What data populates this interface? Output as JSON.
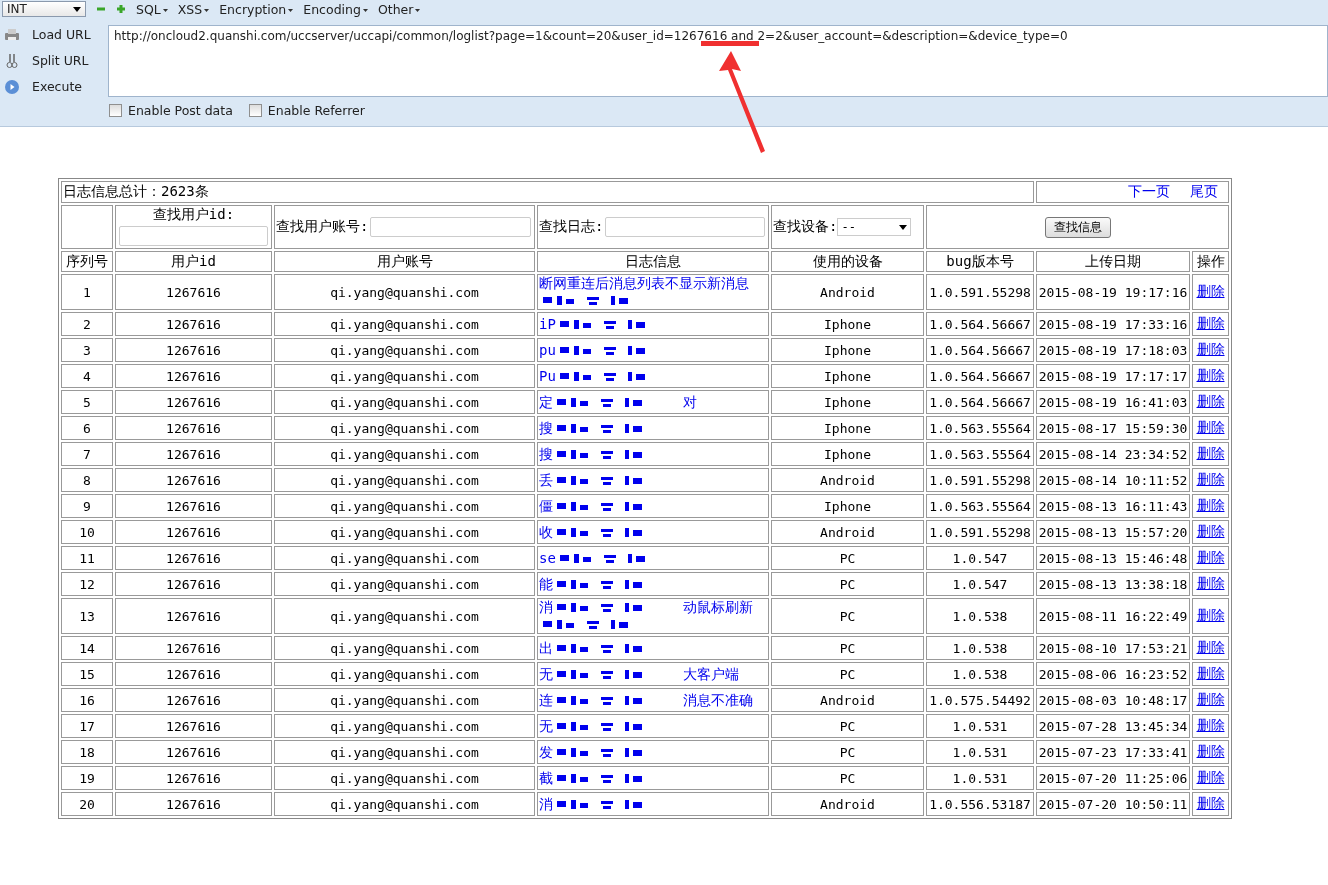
{
  "toolbar": {
    "type_select": "INT",
    "menus": [
      "SQL",
      "XSS",
      "Encryption",
      "Encoding",
      "Other"
    ]
  },
  "actions": [
    {
      "kind": "load",
      "label": "Load URL"
    },
    {
      "kind": "split",
      "label": "Split URL"
    },
    {
      "kind": "execute",
      "label": "Execute"
    }
  ],
  "url": "http://oncloud2.quanshi.com/uccserver/uccapi/common/loglist?page=1&count=20&user_id=1267616 and 2=2&user_account=&description=&device_type=0",
  "options": [
    {
      "label": "Enable Post data",
      "checked": false
    },
    {
      "label": "Enable Referrer",
      "checked": false
    }
  ],
  "summary": "日志信息总计：2623条",
  "pager": [
    "下一页",
    "尾页"
  ],
  "filters": {
    "user_id_label": "查找用户id:",
    "account_label": "查找用户账号:",
    "log_label": "查找日志:",
    "device_label": "查找设备:",
    "device_value": "--",
    "button": "查找信息"
  },
  "columns": [
    "序列号",
    "用户id",
    "用户账号",
    "日志信息",
    "使用的设备",
    "bug版本号",
    "上传日期",
    "操作"
  ],
  "rows": [
    {
      "n": "1",
      "id": "1267616",
      "account": "qi.yang@quanshi.com",
      "log": [
        {
          "kind": "text",
          "text": "断网重连后消息列表不显示新消息"
        },
        {
          "kind": "redacted"
        }
      ],
      "device": "Android",
      "version": "1.0.591.55298",
      "date": "2015-08-19 19:17:16",
      "action": "删除"
    },
    {
      "n": "2",
      "id": "1267616",
      "account": "qi.yang@quanshi.com",
      "log": [
        {
          "kind": "text",
          "text": "iP"
        },
        {
          "kind": "redacted"
        }
      ],
      "device": "Iphone",
      "version": "1.0.564.56667",
      "date": "2015-08-19 17:33:16",
      "action": "删除"
    },
    {
      "n": "3",
      "id": "1267616",
      "account": "qi.yang@quanshi.com",
      "log": [
        {
          "kind": "text",
          "text": "pu"
        },
        {
          "kind": "redacted"
        }
      ],
      "device": "Iphone",
      "version": "1.0.564.56667",
      "date": "2015-08-19 17:18:03",
      "action": "删除"
    },
    {
      "n": "4",
      "id": "1267616",
      "account": "qi.yang@quanshi.com",
      "log": [
        {
          "kind": "text",
          "text": "Pu"
        },
        {
          "kind": "redacted"
        }
      ],
      "device": "Iphone",
      "version": "1.0.564.56667",
      "date": "2015-08-19 17:17:17",
      "action": "删除"
    },
    {
      "n": "5",
      "id": "1267616",
      "account": "qi.yang@quanshi.com",
      "log": [
        {
          "kind": "text",
          "text": "定"
        },
        {
          "kind": "redacted"
        },
        {
          "kind": "text",
          "text": "对"
        }
      ],
      "device": "Iphone",
      "version": "1.0.564.56667",
      "date": "2015-08-19 16:41:03",
      "action": "删除"
    },
    {
      "n": "6",
      "id": "1267616",
      "account": "qi.yang@quanshi.com",
      "log": [
        {
          "kind": "text",
          "text": "搜"
        },
        {
          "kind": "redacted"
        }
      ],
      "device": "Iphone",
      "version": "1.0.563.55564",
      "date": "2015-08-17 15:59:30",
      "action": "删除"
    },
    {
      "n": "7",
      "id": "1267616",
      "account": "qi.yang@quanshi.com",
      "log": [
        {
          "kind": "text",
          "text": "搜"
        },
        {
          "kind": "redacted"
        }
      ],
      "device": "Iphone",
      "version": "1.0.563.55564",
      "date": "2015-08-14 23:34:52",
      "action": "删除"
    },
    {
      "n": "8",
      "id": "1267616",
      "account": "qi.yang@quanshi.com",
      "log": [
        {
          "kind": "text",
          "text": "丢"
        },
        {
          "kind": "redacted"
        }
      ],
      "device": "Android",
      "version": "1.0.591.55298",
      "date": "2015-08-14 10:11:52",
      "action": "删除"
    },
    {
      "n": "9",
      "id": "1267616",
      "account": "qi.yang@quanshi.com",
      "log": [
        {
          "kind": "text",
          "text": "僵"
        },
        {
          "kind": "redacted"
        }
      ],
      "device": "Iphone",
      "version": "1.0.563.55564",
      "date": "2015-08-13 16:11:43",
      "action": "删除"
    },
    {
      "n": "10",
      "id": "1267616",
      "account": "qi.yang@quanshi.com",
      "log": [
        {
          "kind": "text",
          "text": "收"
        },
        {
          "kind": "redacted"
        }
      ],
      "device": "Android",
      "version": "1.0.591.55298",
      "date": "2015-08-13 15:57:20",
      "action": "删除"
    },
    {
      "n": "11",
      "id": "1267616",
      "account": "qi.yang@quanshi.com",
      "log": [
        {
          "kind": "text",
          "text": "se"
        },
        {
          "kind": "redacted"
        }
      ],
      "device": "PC",
      "version": "1.0.547",
      "date": "2015-08-13 15:46:48",
      "action": "删除"
    },
    {
      "n": "12",
      "id": "1267616",
      "account": "qi.yang@quanshi.com",
      "log": [
        {
          "kind": "text",
          "text": "能"
        },
        {
          "kind": "redacted"
        }
      ],
      "device": "PC",
      "version": "1.0.547",
      "date": "2015-08-13 13:38:18",
      "action": "删除"
    },
    {
      "n": "13",
      "id": "1267616",
      "account": "qi.yang@quanshi.com",
      "log": [
        {
          "kind": "text",
          "text": "消"
        },
        {
          "kind": "redacted"
        },
        {
          "kind": "text",
          "text": "动鼠标刷新"
        },
        {
          "kind": "redacted"
        }
      ],
      "device": "PC",
      "version": "1.0.538",
      "date": "2015-08-11 16:22:49",
      "action": "删除"
    },
    {
      "n": "14",
      "id": "1267616",
      "account": "qi.yang@quanshi.com",
      "log": [
        {
          "kind": "text",
          "text": "出"
        },
        {
          "kind": "redacted"
        }
      ],
      "device": "PC",
      "version": "1.0.538",
      "date": "2015-08-10 17:53:21",
      "action": "删除"
    },
    {
      "n": "15",
      "id": "1267616",
      "account": "qi.yang@quanshi.com",
      "log": [
        {
          "kind": "text",
          "text": "无"
        },
        {
          "kind": "redacted"
        },
        {
          "kind": "text",
          "text": "大客户端"
        }
      ],
      "device": "PC",
      "version": "1.0.538",
      "date": "2015-08-06 16:23:52",
      "action": "删除"
    },
    {
      "n": "16",
      "id": "1267616",
      "account": "qi.yang@quanshi.com",
      "log": [
        {
          "kind": "text",
          "text": "连"
        },
        {
          "kind": "redacted"
        },
        {
          "kind": "text",
          "text": "消息不准确"
        }
      ],
      "device": "Android",
      "version": "1.0.575.54492",
      "date": "2015-08-03 10:48:17",
      "action": "删除"
    },
    {
      "n": "17",
      "id": "1267616",
      "account": "qi.yang@quanshi.com",
      "log": [
        {
          "kind": "text",
          "text": "无"
        },
        {
          "kind": "redacted"
        }
      ],
      "device": "PC",
      "version": "1.0.531",
      "date": "2015-07-28 13:45:34",
      "action": "删除"
    },
    {
      "n": "18",
      "id": "1267616",
      "account": "qi.yang@quanshi.com",
      "log": [
        {
          "kind": "text",
          "text": "发"
        },
        {
          "kind": "redacted"
        }
      ],
      "device": "PC",
      "version": "1.0.531",
      "date": "2015-07-23 17:33:41",
      "action": "删除"
    },
    {
      "n": "19",
      "id": "1267616",
      "account": "qi.yang@quanshi.com",
      "log": [
        {
          "kind": "text",
          "text": "截"
        },
        {
          "kind": "redacted"
        }
      ],
      "device": "PC",
      "version": "1.0.531",
      "date": "2015-07-20 11:25:06",
      "action": "删除"
    },
    {
      "n": "20",
      "id": "1267616",
      "account": "qi.yang@quanshi.com",
      "log": [
        {
          "kind": "text",
          "text": "消"
        },
        {
          "kind": "redacted"
        }
      ],
      "device": "Android",
      "version": "1.0.556.53187",
      "date": "2015-07-20 10:50:11",
      "action": "删除"
    }
  ]
}
